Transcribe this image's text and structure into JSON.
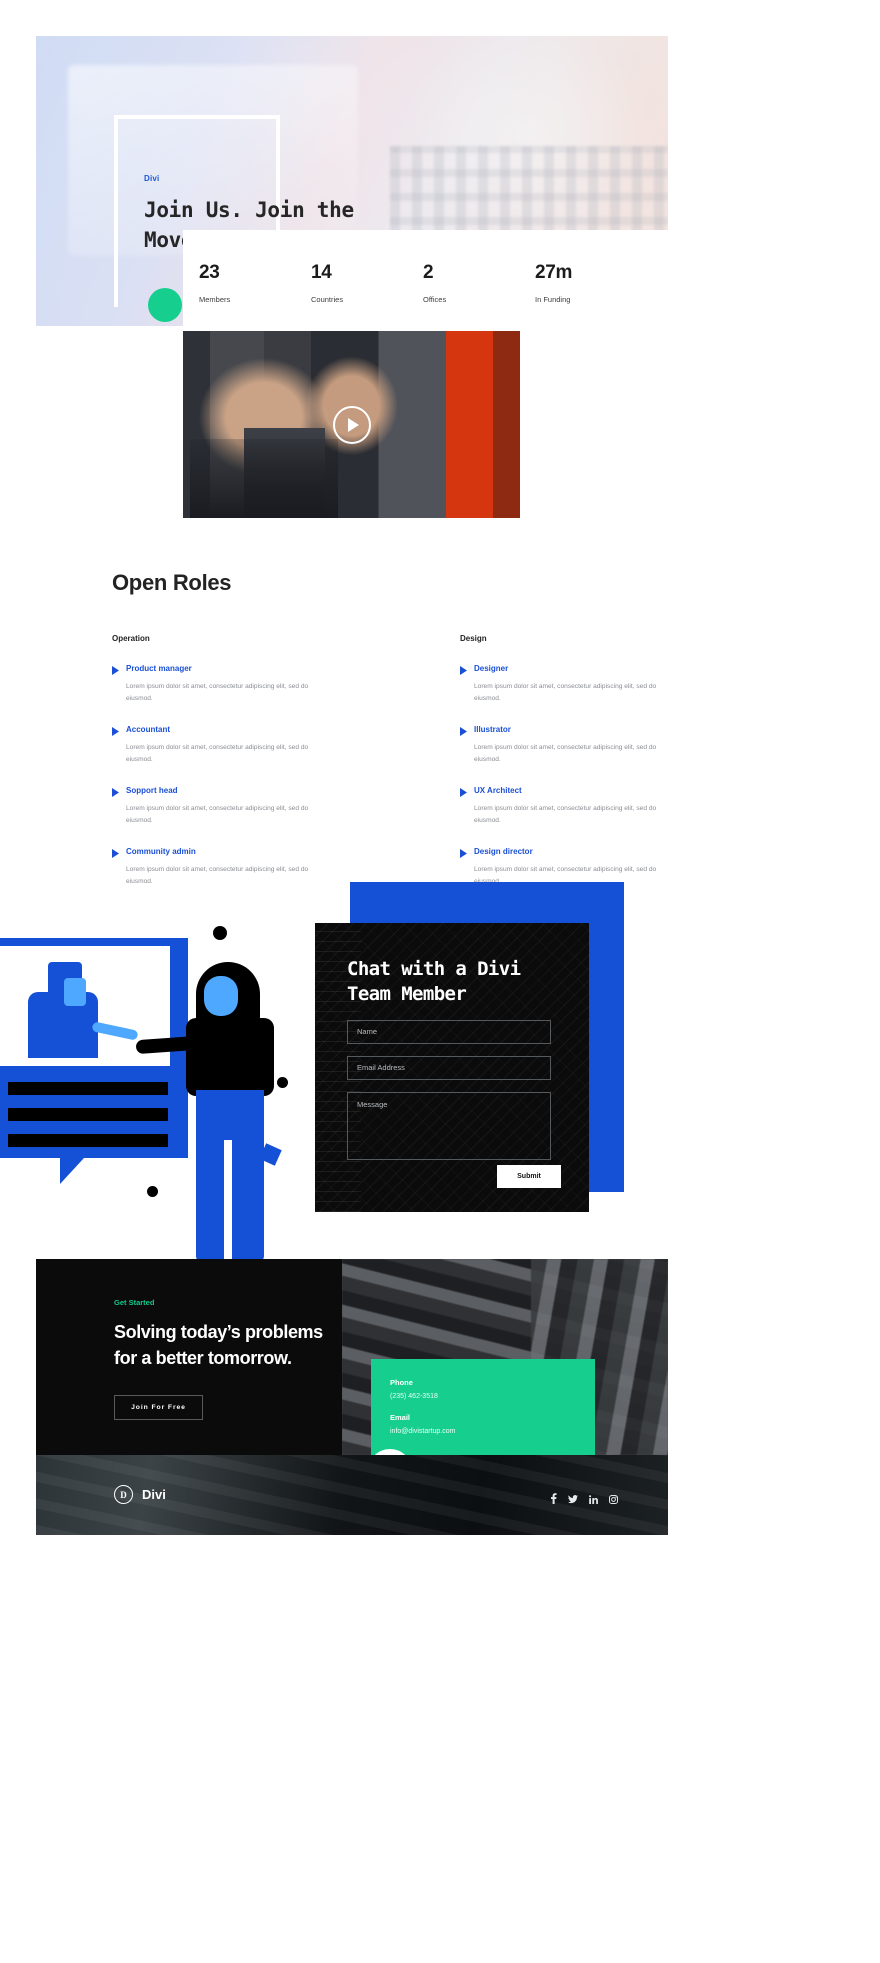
{
  "hero": {
    "eyebrow": "Divi",
    "title": "Join Us. Join the Movement."
  },
  "stats": [
    {
      "number": "23",
      "label": "Members"
    },
    {
      "number": "14",
      "label": "Countries"
    },
    {
      "number": "2",
      "label": "Offices"
    },
    {
      "number": "27m",
      "label": "In Funding"
    }
  ],
  "video": {
    "play_icon": "play-icon"
  },
  "roles": {
    "title": "Open Roles",
    "columns": [
      {
        "heading": "Operation",
        "items": [
          {
            "name": "Product manager",
            "desc": "Lorem ipsum dolor sit amet, consectetur adipiscing elit, sed do eiusmod."
          },
          {
            "name": "Accountant",
            "desc": "Lorem ipsum dolor sit amet, consectetur adipiscing elit, sed do eiusmod."
          },
          {
            "name": "Sopport head",
            "desc": "Lorem ipsum dolor sit amet, consectetur adipiscing elit, sed do eiusmod."
          },
          {
            "name": "Community admin",
            "desc": "Lorem ipsum dolor sit amet, consectetur adipiscing elit, sed do eiusmod."
          }
        ]
      },
      {
        "heading": "Design",
        "items": [
          {
            "name": "Designer",
            "desc": "Lorem ipsum dolor sit amet, consectetur adipiscing elit, sed do eiusmod."
          },
          {
            "name": "Illustrator",
            "desc": "Lorem ipsum dolor sit amet, consectetur adipiscing elit, sed do eiusmod."
          },
          {
            "name": "UX Architect",
            "desc": "Lorem ipsum dolor sit amet, consectetur adipiscing elit, sed do eiusmod."
          },
          {
            "name": "Design director",
            "desc": "Lorem ipsum dolor sit amet, consectetur adipiscing elit, sed do eiusmod."
          }
        ]
      }
    ]
  },
  "chat": {
    "title": "Chat with a Divi Team Member",
    "name_placeholder": "Name",
    "email_placeholder": "Email Address",
    "message_placeholder": "Message",
    "submit_label": "Submit"
  },
  "cta": {
    "eyebrow": "Get Started",
    "heading": "Solving today’s problems for a better tomorrow.",
    "button_label": "Join For Free"
  },
  "contact": {
    "phone_label": "Phone",
    "phone_value": "(235) 462-3518",
    "email_label": "Email",
    "email_value": "info@divistartup.com"
  },
  "footer": {
    "brand_mark": "D",
    "brand_name": "Divi",
    "socials": [
      {
        "icon": "facebook-icon",
        "glyph": "f"
      },
      {
        "icon": "twitter-icon",
        "glyph": "ᵛ"
      },
      {
        "icon": "linkedin-icon",
        "glyph": "in"
      },
      {
        "icon": "instagram-icon",
        "glyph": "▢"
      }
    ]
  },
  "colors": {
    "blue": "#1551d6",
    "link_blue": "#1a4fd6",
    "green": "#16cf8f",
    "black": "#0b0b0b"
  }
}
